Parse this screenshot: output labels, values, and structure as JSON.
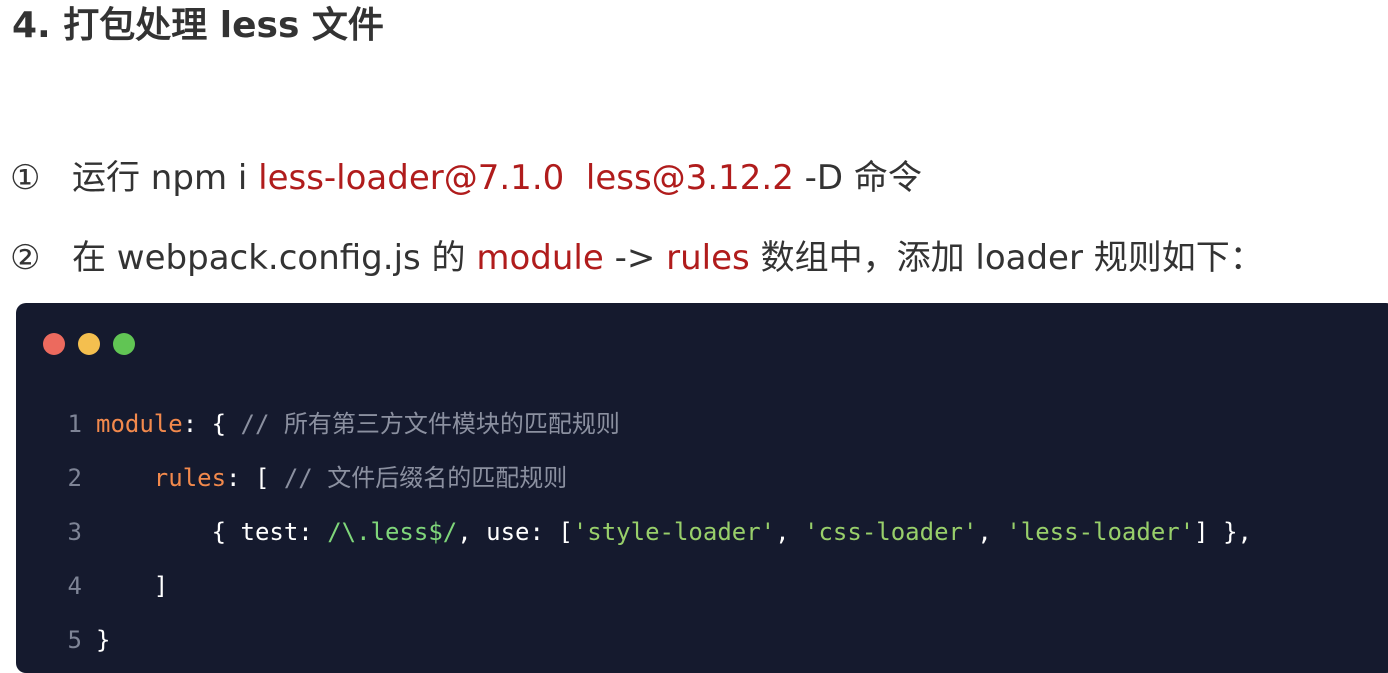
{
  "heading": "4. 打包处理 less 文件",
  "steps": [
    {
      "marker": "①",
      "pre": "运行 npm i ",
      "hl1": "less-loader@7.1.0",
      "hl2": "less@3.12.2",
      "post": " -D 命令"
    },
    {
      "marker": "②",
      "pre": "在 webpack.config.js 的 ",
      "hl1": "module",
      "mid": " -> ",
      "hl2": "rules",
      "post": " 数组中，添加 loader 规则如下："
    }
  ],
  "code": {
    "lines": [
      {
        "n": "1",
        "indent": "",
        "key": "module",
        "punct": ": { ",
        "comment": "// 所有第三方文件模块的匹配规则"
      },
      {
        "n": "2",
        "indent": "    ",
        "key": "rules",
        "punct": ": [ ",
        "comment": "// 文件后缀名的匹配规则"
      },
      {
        "n": "3",
        "indent": "        ",
        "open": "{ test: ",
        "regex": "/\\.less$/",
        "mid": ", use: [",
        "s1": "'style-loader'",
        "sep1": ", ",
        "s2": "'css-loader'",
        "sep2": ", ",
        "s3": "'less-loader'",
        "close": "] },"
      },
      {
        "n": "4",
        "indent": "    ",
        "text": "]"
      },
      {
        "n": "5",
        "indent": "",
        "text": "}"
      }
    ]
  },
  "colors": {
    "highlight": "#b01c1c",
    "code_bg": "#151a2e",
    "keyword": "#f2894c",
    "string": "#98cf6a",
    "comment": "#8b90a0",
    "dot_red": "#ec6a5e",
    "dot_yellow": "#f4bf4f",
    "dot_green": "#61c554"
  }
}
